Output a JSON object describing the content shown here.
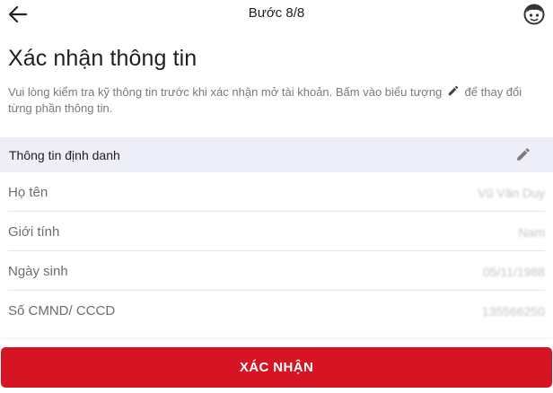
{
  "header": {
    "step_label": "Bước 8/8",
    "back_icon": "arrow-left-icon",
    "help_icon": "support-agent-icon"
  },
  "title": "Xác nhận thông tin",
  "description": {
    "before_icon": "Vui lòng kiểm tra kỹ thông tin trước khi xác nhận mở tài khoản. Bấm vào biểu tượng",
    "icon": "pencil-icon",
    "after_icon": "để thay đổi từng phần thông tin."
  },
  "section": {
    "title": "Thông tin định danh",
    "edit_icon": "pencil-icon"
  },
  "fields": [
    {
      "label": "Họ tên",
      "value": "Vũ Văn Duy"
    },
    {
      "label": "Giới tính",
      "value": "Nam"
    },
    {
      "label": "Ngày sinh",
      "value": "05/11/1988"
    },
    {
      "label": "Số CMND/ CCCD",
      "value": "135566250"
    }
  ],
  "confirm_button": "XÁC NHẬN",
  "colors": {
    "primary": "#d61424",
    "section_bg": "#eeeef8"
  }
}
